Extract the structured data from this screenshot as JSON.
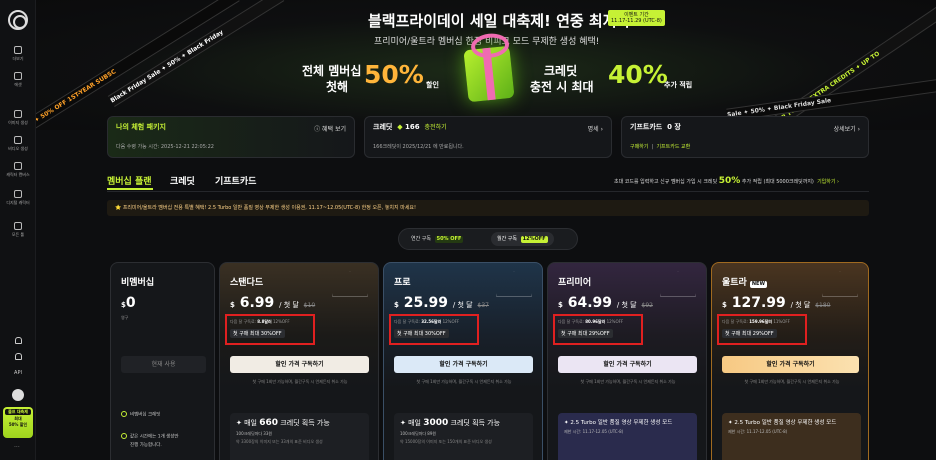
{
  "sidebar": {
    "items": [
      {
        "label": "더보기"
      },
      {
        "label": "에셋"
      },
      {
        "label": "이미지 생성"
      },
      {
        "label": "비디오 생성"
      },
      {
        "label": "캐릭터 캔버스"
      },
      {
        "label": "디지털 캐릭터"
      },
      {
        "label": "모든 툴"
      }
    ],
    "api_label": "API",
    "promo": {
      "top": "블프 대축제",
      "mid": "최대",
      "bottom": "50% 할인"
    }
  },
  "banner": {
    "title": "블랙프라이데이 세일 대축제! 연중 최저가!",
    "subtitle": "프리미어/울트라 멤버십 한정 비피크 모드 무제한 생성 혜택!",
    "date_tag": [
      "이벤트 기간",
      "11.17-11.29 (UTC-8)"
    ],
    "left_line1": "전체 멤버십",
    "left_line2": "첫해",
    "left_big": "50%",
    "left_unit": "할인",
    "right_line1": "크레딧",
    "right_line2": "충전 시 최대",
    "right_big": "40%",
    "right_unit": "추가 적립",
    "ribbons": [
      "PTION ✦ 50% OFF 1ST-YEAR SUBSC",
      "Black Friday Sale ✦ 50% ✦ Black Friday",
      "UP TO 40% EXTRA CREDITS ✦ UP TO",
      "Sale ✦ 50% ✦ Black Friday Sale"
    ]
  },
  "cards": {
    "trial": {
      "title": "나의 체험 패키지",
      "link": "ⓘ 혜택 보기",
      "sub": "다음 수령 가능 시간: 2025-12-21 22:05:22"
    },
    "credit": {
      "title": "크레딧",
      "amount": "166",
      "action": "충전하기",
      "link": "명세 ›",
      "sub": "166크레딧이 2025/12/21 에 만료됩니다."
    },
    "giftcard": {
      "title": "기프트카드",
      "count": "0 장",
      "link": "상세보기 ›",
      "buy": "구매하기",
      "exchange": "기프트카드 교환"
    }
  },
  "tabs": [
    {
      "label": "멤버십 플랜"
    },
    {
      "label": "크레딧"
    },
    {
      "label": "기프트카드"
    }
  ],
  "invite": {
    "text": "초대 코드를 입력하고 신규 멤버십 가입 시 크레딧",
    "pct": "50%",
    "text2": "추가 적립 (최대 5000크레딧까지)",
    "link": "기입하기 ›"
  },
  "notice": "⭐ 프리미어/울트라 멤버십 전용 특별 혜택! 2.5 Turbo 일반 품질 영상 무제한 생성 이용권, 11.17~12.05(UTC-8) 한정 오픈, 놓치지 마세요!",
  "billing": {
    "annual": "연간 구독",
    "annual_pill": "50% OFF",
    "monthly": "월간 구독",
    "monthly_pill": "12%OFF"
  },
  "plans": [
    {
      "name": "비멤버십",
      "currency": "$",
      "price": "0",
      "per": "영구",
      "button": "현재 사용",
      "features": [
        "비멤버십 크레딧",
        "같은 시간에는 1개 생성만",
        "진행 가능합니다."
      ]
    },
    {
      "name": "스탠다드",
      "currency": "$",
      "price": "6.99",
      "per": "/ 첫 달",
      "orig": "$10",
      "note_prefix": "다음 달 구독료:",
      "note_value": "8.8달러",
      "note_suffix": "12%OFF",
      "badge": "첫 구매 최대 30%OFF",
      "button": "할인 가격 구독하기",
      "cancel": "첫 구매 1회만 가능하며, 월간구독 시 언제든지 취소 가능",
      "feat_prefix": "매일",
      "feat_value": "660",
      "feat_suffix": "크레딧 획득 가능",
      "feat_line1": "100크레딧마다 33원",
      "feat_line2": "약 3300장의 이미지 또는 33개의 표준 비디오 생성"
    },
    {
      "name": "프로",
      "currency": "$",
      "price": "25.99",
      "per": "/ 첫 달",
      "orig": "$37",
      "note_prefix": "다음 달 구독료:",
      "note_value": "32.56달러",
      "note_suffix": "12%OFF",
      "badge": "첫 구매 최대 30%OFF",
      "button": "할인 가격 구독하기",
      "cancel": "첫 구매 1회만 가능하며, 월간구독 시 언제든지 취소 가능",
      "feat_prefix": "매일",
      "feat_value": "3000",
      "feat_suffix": "크레딧 획득 가능",
      "feat_line1": "100크레딧마다 89원",
      "feat_line2": "약 15000장의 이미지 또는 150개의 표준 비디오 생성"
    },
    {
      "name": "프리미어",
      "currency": "$",
      "price": "64.99",
      "per": "/ 첫 달",
      "orig": "$92",
      "note_prefix": "다음 달 구독료:",
      "note_value": "80.96달러",
      "note_suffix": "12%OFF",
      "badge": "첫 구매 최대 29%OFF",
      "button": "할인 가격 구독하기",
      "cancel": "첫 구매 1회만 가능하며, 월간구독 시 언제든지 취소 가능",
      "feat_title": "2.5 Turbo 일반 품질 영상 무제한 생성 모드",
      "feat_line1": "제한 시간: 11.17-12.05  (UTC-8)"
    },
    {
      "name": "울트라",
      "new": "NEW",
      "currency": "$",
      "price": "127.99",
      "per": "/ 첫 달",
      "orig": "$180",
      "note_prefix": "다음 달 구독료:",
      "note_value": "159.96달러",
      "note_suffix": "11%OFF",
      "badge": "첫 구매 최대 29%OFF",
      "button": "할인 가격 구독하기",
      "cancel": "첫 구매 1회만 가능하며, 월간구독 시 언제든지 취소 가능",
      "feat_title": "2.5 Turbo 일반 품질 영상 무제한 생성 모드",
      "feat_line1": "제한 시간: 11.17-12.05  (UTC-8)"
    }
  ],
  "colors": {
    "accent": "#c6f135",
    "highlight_box": "#e02020",
    "bg": "#0d0e10"
  }
}
